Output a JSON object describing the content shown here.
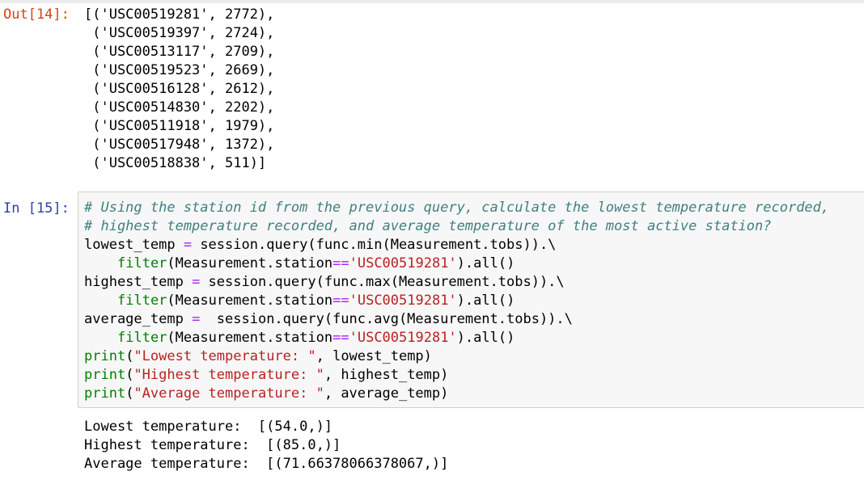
{
  "out_cell": {
    "prompt": "Out[14]:",
    "lines": [
      "[('USC00519281', 2772),",
      " ('USC00519397', 2724),",
      " ('USC00513117', 2709),",
      " ('USC00519523', 2669),",
      " ('USC00516128', 2612),",
      " ('USC00514830', 2202),",
      " ('USC00511918', 1979),",
      " ('USC00517948', 1372),",
      " ('USC00518838', 511)]"
    ]
  },
  "in_cell": {
    "prompt": "In [15]:",
    "comment1": "# Using the station id from the previous query, calculate the lowest temperature recorded,",
    "comment2": "# highest temperature recorded, and average temperature of the most active station?",
    "l3": {
      "var": "lowest_temp ",
      "op": "=",
      "rest": " session.query(func.min(Measurement.tobs)).\\"
    },
    "l4": {
      "fn": "filter",
      "pre": "(Measurement.station",
      "op": "==",
      "str": "'USC00519281'",
      "post": ").all()"
    },
    "l5": {
      "var": "highest_temp ",
      "op": "=",
      "rest": " session.query(func.max(Measurement.tobs)).\\"
    },
    "l6": {
      "fn": "filter",
      "pre": "(Measurement.station",
      "op": "==",
      "str": "'USC00519281'",
      "post": ").all()"
    },
    "l7": {
      "var": "average_temp ",
      "op": "=",
      "rest": "  session.query(func.avg(Measurement.tobs)).\\"
    },
    "l8": {
      "fn": "filter",
      "pre": "(Measurement.station",
      "op": "==",
      "str": "'USC00519281'",
      "post": ").all()"
    },
    "l9": {
      "fn": "print",
      "open": "(",
      "str": "\"Lowest temperature: \"",
      "post": ", lowest_temp)"
    },
    "l10": {
      "fn": "print",
      "open": "(",
      "str": "\"Highest temperature: \"",
      "post": ", highest_temp)"
    },
    "l11": {
      "fn": "print",
      "open": "(",
      "str": "\"Average temperature: \"",
      "post": ", average_temp)"
    }
  },
  "out_15": {
    "lines": [
      "Lowest temperature:  [(54.0,)]",
      "Highest temperature:  [(85.0,)]",
      "Average temperature:  [(71.66378066378067,)]"
    ]
  },
  "colors": {
    "out_prompt": "#d84315",
    "in_prompt": "#303f9f",
    "comment": "#408080",
    "operator": "#aa22ff",
    "string": "#ba2121",
    "builtin": "#008000"
  }
}
